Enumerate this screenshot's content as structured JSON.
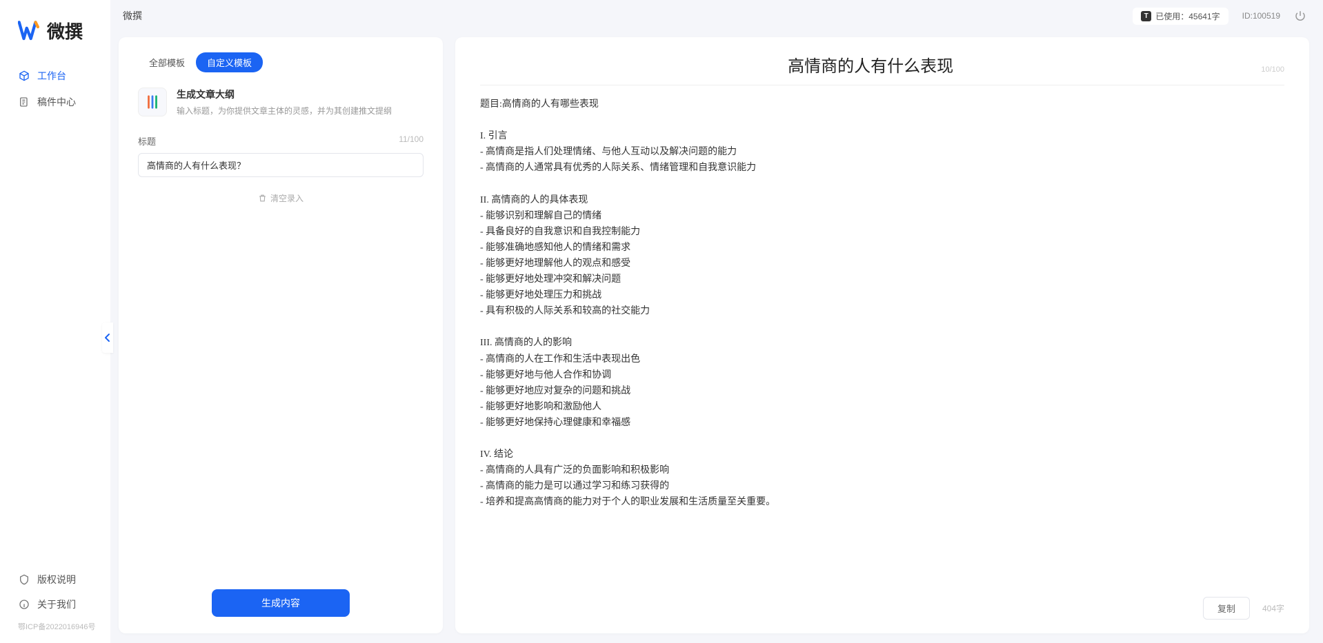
{
  "app_name": "微撰",
  "sidebar": {
    "nav": [
      {
        "label": "工作台",
        "icon": "cube-icon",
        "active": true
      },
      {
        "label": "稿件中心",
        "icon": "doc-list-icon",
        "active": false
      }
    ],
    "bottom": [
      {
        "label": "版权说明",
        "icon": "shield-icon"
      },
      {
        "label": "关于我们",
        "icon": "info-icon"
      }
    ],
    "icp": "鄂ICP备2022016946号"
  },
  "topbar": {
    "title": "微撰",
    "usage_prefix": "已使用：",
    "usage_value": "45641字",
    "user_id_label": "ID:100519"
  },
  "left": {
    "tabs": [
      {
        "label": "全部模板",
        "active": false
      },
      {
        "label": "自定义模板",
        "active": true
      }
    ],
    "template": {
      "title": "生成文章大纲",
      "desc": "输入标题，为你提供文章主体的灵感，并为其创建推文提纲"
    },
    "form": {
      "label": "标题",
      "count": "11/100",
      "value": "高情商的人有什么表现？",
      "clear": "清空录入"
    },
    "generate": "生成内容"
  },
  "right": {
    "title": "高情商的人有什么表现",
    "count_top": "10/100",
    "body": "题目:高情商的人有哪些表现\n\nI. 引言\n- 高情商是指人们处理情绪、与他人互动以及解决问题的能力\n- 高情商的人通常具有优秀的人际关系、情绪管理和自我意识能力\n\nII. 高情商的人的具体表现\n- 能够识别和理解自己的情绪\n- 具备良好的自我意识和自我控制能力\n- 能够准确地感知他人的情绪和需求\n- 能够更好地理解他人的观点和感受\n- 能够更好地处理冲突和解决问题\n- 能够更好地处理压力和挑战\n- 具有积极的人际关系和较高的社交能力\n\nIII. 高情商的人的影响\n- 高情商的人在工作和生活中表现出色\n- 能够更好地与他人合作和协调\n- 能够更好地应对复杂的问题和挑战\n- 能够更好地影响和激励他人\n- 能够更好地保持心理健康和幸福感\n\nIV. 结论\n- 高情商的人具有广泛的负面影响和积极影响\n- 高情商的能力是可以通过学习和练习获得的\n- 培养和提高高情商的能力对于个人的职业发展和生活质量至关重要。",
    "copy": "复制",
    "char_count": "404字"
  }
}
